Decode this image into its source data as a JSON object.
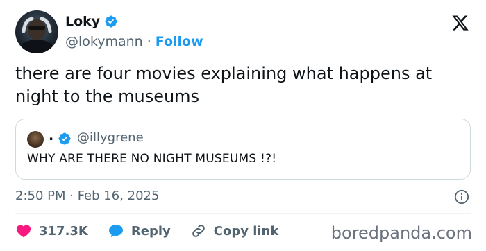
{
  "author": {
    "display_name": "Loky",
    "handle": "@lokymann",
    "separator": "·",
    "follow_label": "Follow"
  },
  "tweet": {
    "text": "there are four movies explaining what happens at night to the museums",
    "timestamp": "2:50 PM · Feb 16, 2025"
  },
  "quote": {
    "display_name": ".",
    "handle": "@illygrene",
    "text": "WHY ARE THERE NO NIGHT MUSEUMS !?!"
  },
  "actions": {
    "like_count": "317.3K",
    "reply_label": "Reply",
    "copy_link_label": "Copy link"
  },
  "watermark": "boredpanda.com",
  "colors": {
    "accent": "#1d9bf0",
    "like": "#f91880",
    "secondary_text": "#536471",
    "border": "#cfd9de"
  },
  "icons": [
    "verified-badge-icon",
    "x-logo-icon",
    "info-icon",
    "heart-icon",
    "reply-icon",
    "link-icon"
  ]
}
